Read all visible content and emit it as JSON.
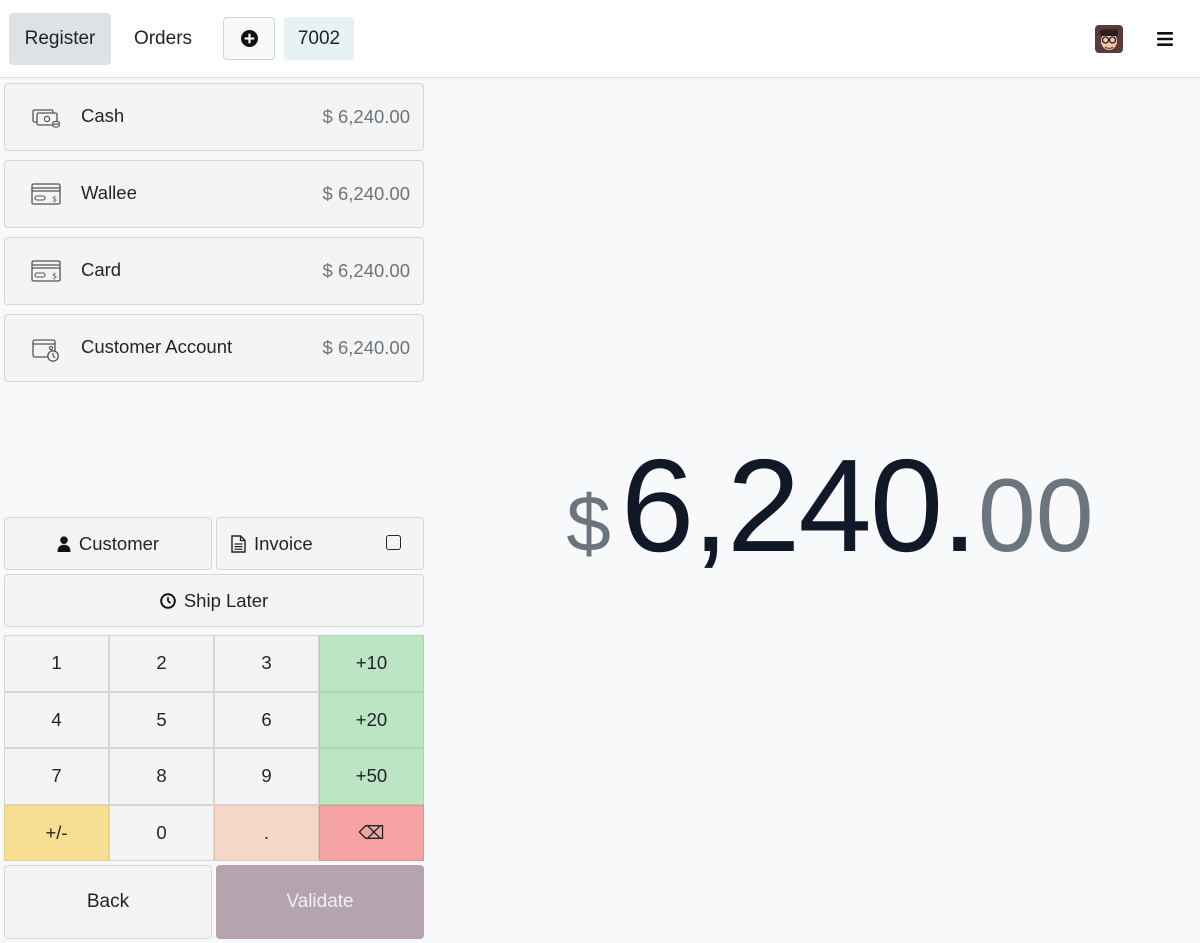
{
  "header": {
    "register_label": "Register",
    "orders_label": "Orders",
    "order_number": "7002"
  },
  "payment_methods": [
    {
      "name": "Cash",
      "amount": "$ 6,240.00",
      "icon": "cash-icon"
    },
    {
      "name": "Wallee",
      "amount": "$ 6,240.00",
      "icon": "payment-terminal-icon"
    },
    {
      "name": "Card",
      "amount": "$ 6,240.00",
      "icon": "credit-card-icon"
    },
    {
      "name": "Customer Account",
      "amount": "$ 6,240.00",
      "icon": "customer-account-icon"
    }
  ],
  "total": {
    "currency": "$",
    "integer": "6,240",
    "separator": ".",
    "decimals": "00"
  },
  "actions": {
    "customer_label": "Customer",
    "invoice_label": "Invoice",
    "ship_later_label": "Ship Later"
  },
  "numpad": {
    "keys": [
      "1",
      "2",
      "3",
      "+10",
      "4",
      "5",
      "6",
      "+20",
      "7",
      "8",
      "9",
      "+50",
      "+/-",
      "0",
      ".",
      "⌫"
    ]
  },
  "footer": {
    "back_label": "Back",
    "validate_label": "Validate"
  },
  "colors": {
    "accent_validate": "#b5a3ae",
    "quick_add": "#bbe5c3",
    "sign_toggle": "#f6df93",
    "decimal_key": "#f5d7c8",
    "backspace_key": "#f5a3a3"
  }
}
